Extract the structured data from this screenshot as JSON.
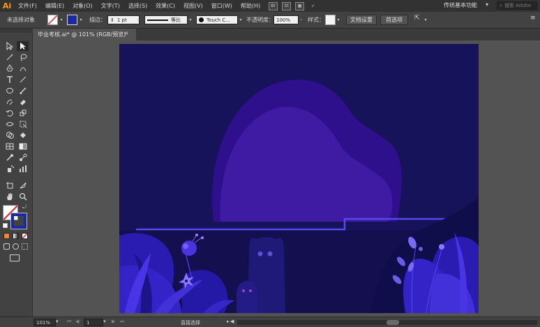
{
  "app": {
    "logo": "Ai"
  },
  "menu": [
    "文件(F)",
    "编辑(E)",
    "对象(O)",
    "文字(T)",
    "选择(S)",
    "效果(C)",
    "视图(V)",
    "窗口(W)",
    "帮助(H)"
  ],
  "menu_icons": [
    "Br",
    "St"
  ],
  "workspace": "传统基本功能",
  "search_placeholder": "搜索 Adobe",
  "control": {
    "selection_status": "未选择对象",
    "stroke_label": "描边：",
    "stroke_value": "1 pt",
    "stroke_style": "等比",
    "brush_name": "Touch C...",
    "opacity_label": "不透明度：",
    "opacity_value": "100%",
    "style_label": "样式：",
    "doc_settings_button": "文档设置",
    "preferences_button": "首选项"
  },
  "document_tab": {
    "title": "毕业考核.ai* @ 101% (RGB/预览)",
    "close": "×"
  },
  "status": {
    "zoom": "101%",
    "page": "1",
    "tool": "直接选择"
  },
  "colors": {
    "artboard_bg": "#16135a",
    "blob_outer": "#2e0f8c",
    "blob_inner": "#3f1aa3",
    "ledge_line": "#5548f0",
    "ground": "#0f0d4a",
    "leaf_bright": "#3a25d8",
    "leaf_mid": "#2a1cb0",
    "accent_orange": "#ff9a00"
  }
}
